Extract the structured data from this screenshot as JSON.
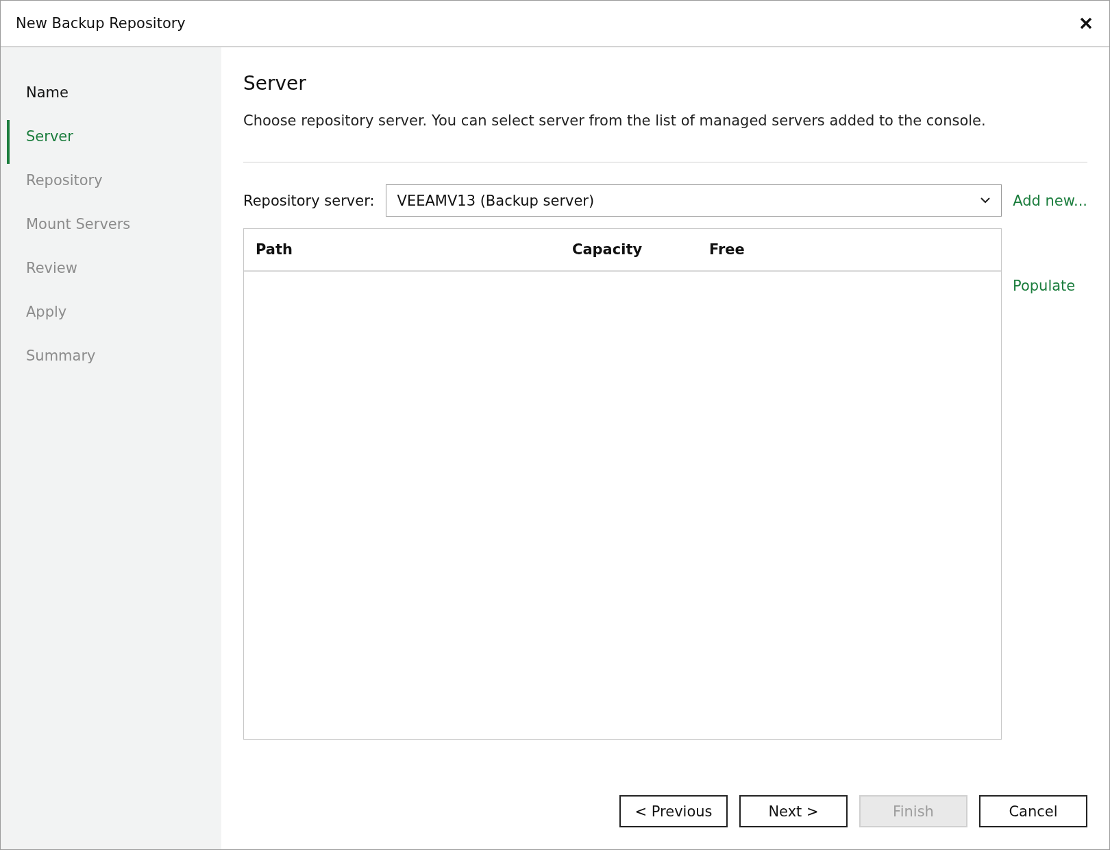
{
  "window": {
    "title": "New Backup Repository"
  },
  "steps": [
    {
      "label": "Name",
      "selected": false,
      "enabled": true
    },
    {
      "label": "Server",
      "selected": true,
      "enabled": true
    },
    {
      "label": "Repository",
      "selected": false,
      "enabled": false
    },
    {
      "label": "Mount Servers",
      "selected": false,
      "enabled": false
    },
    {
      "label": "Review",
      "selected": false,
      "enabled": false
    },
    {
      "label": "Apply",
      "selected": false,
      "enabled": false
    },
    {
      "label": "Summary",
      "selected": false,
      "enabled": false
    }
  ],
  "page": {
    "heading": "Server",
    "description": "Choose repository server. You can select server from the list of managed servers added to the console.",
    "server_label": "Repository server:",
    "server_value": "VEEAMV13 (Backup server)",
    "add_new": "Add new...",
    "table": {
      "columns": [
        "Path",
        "Capacity",
        "Free"
      ]
    },
    "populate": "Populate"
  },
  "buttons": [
    {
      "label": "< Previous",
      "disabled": false
    },
    {
      "label": "Next >",
      "disabled": false
    },
    {
      "label": "Finish",
      "disabled": true
    },
    {
      "label": "Cancel",
      "disabled": false
    }
  ]
}
